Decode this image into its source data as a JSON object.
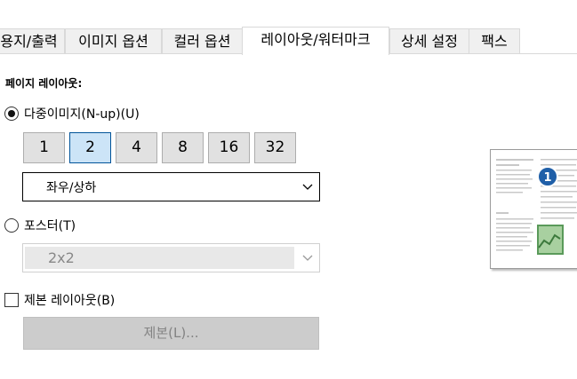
{
  "tabs": [
    {
      "label": "용지/출력"
    },
    {
      "label": "이미지 옵션"
    },
    {
      "label": "컬러 옵션"
    },
    {
      "label": "레이아웃/워터마크",
      "active": true
    },
    {
      "label": "상세 설정"
    },
    {
      "label": "팩스"
    }
  ],
  "section_title": "페이지 레이아웃:",
  "nup": {
    "label": "다중이미지(N-up)(U)",
    "selected": true,
    "buttons": [
      "1",
      "2",
      "4",
      "8",
      "16",
      "32"
    ],
    "selected_value": "2",
    "order_select": {
      "value": "좌우/상하"
    }
  },
  "poster": {
    "label": "포스터(T)",
    "selected": false,
    "size_select": {
      "value": "2x2"
    }
  },
  "booklet": {
    "label": "제본 레이아웃(B)",
    "checked": false,
    "button_label": "제본(L)..."
  },
  "preview": {
    "badge_number": "1"
  },
  "colors": {
    "accent": "#005499",
    "badge": "#1f5fa8"
  }
}
